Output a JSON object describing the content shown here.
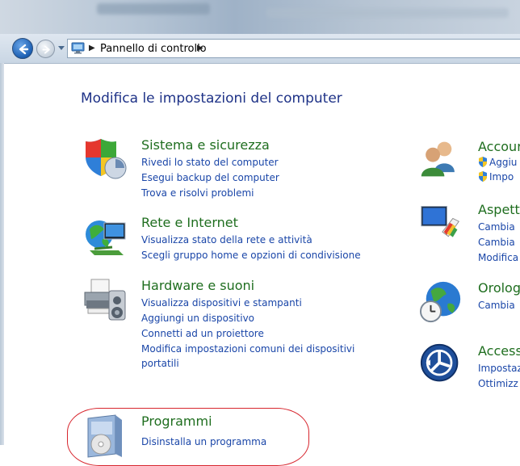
{
  "window": {
    "address_path": "Pannello di controllo"
  },
  "page": {
    "title": "Modifica le impostazioni del computer"
  },
  "left_categories": [
    {
      "title": "Sistema e sicurezza",
      "icon": "shield-icon",
      "links": [
        "Rivedi lo stato del computer",
        "Esegui backup del computer",
        "Trova e risolvi problemi"
      ]
    },
    {
      "title": "Rete e Internet",
      "icon": "network-icon",
      "links": [
        "Visualizza stato della rete e attività",
        "Scegli gruppo home e opzioni di condivisione"
      ]
    },
    {
      "title": "Hardware e suoni",
      "icon": "printer-icon",
      "links": [
        "Visualizza dispositivi e stampanti",
        "Aggiungi un dispositivo",
        "Connetti ad un proiettore",
        "Modifica impostazioni comuni dei dispositivi portatili"
      ]
    },
    {
      "title": "Programmi",
      "icon": "programs-icon",
      "links": [
        "Disinstalla un programma"
      ]
    }
  ],
  "right_categories": [
    {
      "title": "Accour",
      "icon": "users-icon",
      "links": [
        "Aggiu",
        "Impo"
      ]
    },
    {
      "title": "Aspett",
      "icon": "personalization-icon",
      "links": [
        "Cambia",
        "Cambia",
        "Modifica"
      ]
    },
    {
      "title": "Orolog",
      "icon": "clock-globe-icon",
      "links": [
        "Cambia"
      ]
    },
    {
      "title": "Access",
      "icon": "ease-of-access-icon",
      "links": [
        "Impostaz",
        "Ottimizz"
      ]
    }
  ],
  "colors": {
    "title_green": "#1f6e1f",
    "link_blue": "#1a46a8",
    "heading_blue": "#1e3287",
    "highlight_red": "#d7262e"
  }
}
